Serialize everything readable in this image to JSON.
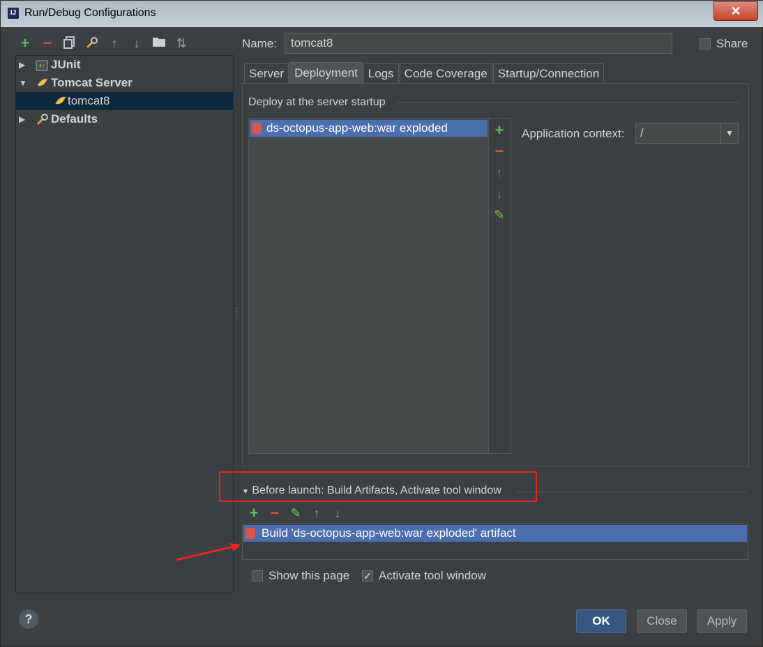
{
  "window": {
    "title": "Run/Debug Configurations",
    "close_glyph": "✕",
    "app_icon_letter": "IJ"
  },
  "left_toolbar": {
    "icons": [
      "add-icon",
      "remove-icon",
      "copy-icon",
      "wrench-icon",
      "move-up-icon",
      "move-down-icon",
      "folder-icon",
      "sort-icon"
    ]
  },
  "tree": {
    "items": [
      {
        "label": "JUnit",
        "arrow": "▶"
      },
      {
        "label": "Tomcat Server",
        "arrow": "▼"
      },
      {
        "label": "tomcat8"
      },
      {
        "label": "Defaults",
        "arrow": "▶"
      }
    ]
  },
  "name_field": {
    "label": "Name:",
    "value": "tomcat8"
  },
  "share": {
    "label": "Share",
    "checked": false
  },
  "tabs": [
    "Server",
    "Deployment",
    "Logs",
    "Code Coverage",
    "Startup/Connection"
  ],
  "active_tab": "Deployment",
  "deployment": {
    "section_title": "Deploy at the server startup",
    "items": [
      "ds-octopus-app-web:war exploded"
    ],
    "context_label": "Application context:",
    "context_value": "/"
  },
  "before_launch": {
    "title": "Before launch: Build Artifacts, Activate tool window",
    "items": [
      "Build 'ds-octopus-app-web:war exploded' artifact"
    ]
  },
  "options": {
    "show_page": {
      "label": "Show this page",
      "checked": false
    },
    "activate_tool": {
      "label": "Activate tool window",
      "checked": true
    }
  },
  "buttons": {
    "ok": "OK",
    "close": "Close",
    "apply": "Apply",
    "help": "?"
  },
  "colors": {
    "accent_selection": "#4b6eaf",
    "annotation_red": "#e8231e",
    "add_green": "#5fb85f",
    "remove_red": "#d9563f"
  }
}
